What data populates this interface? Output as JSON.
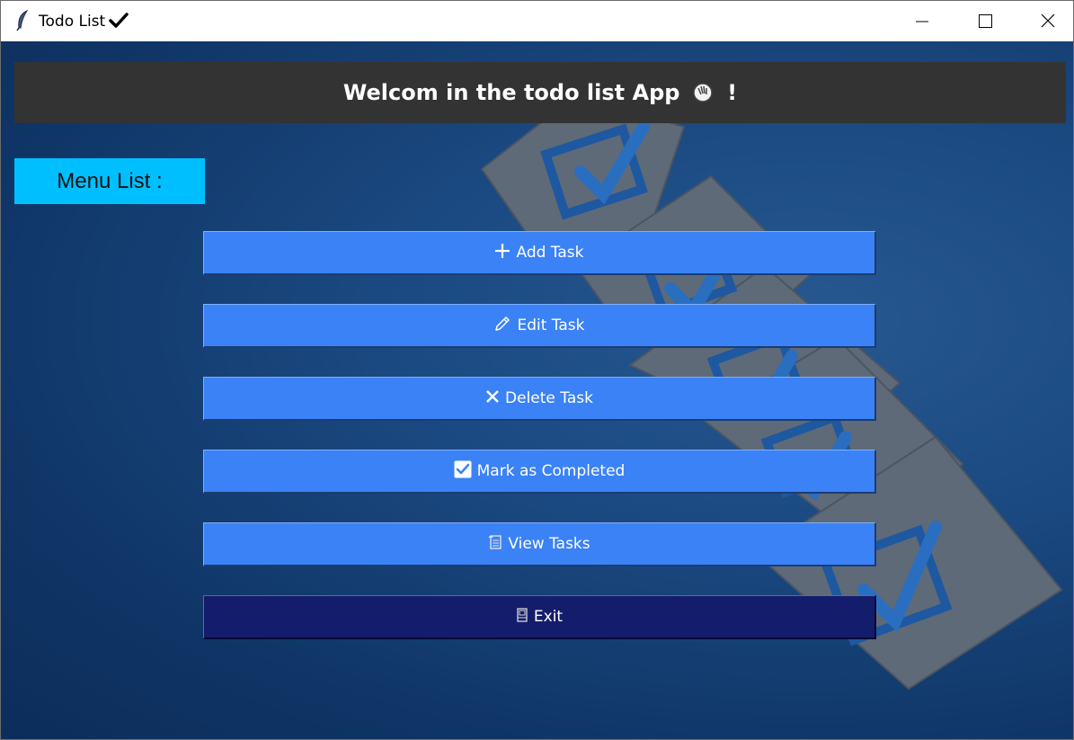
{
  "window": {
    "title": "Todo List",
    "icons": {
      "app": "feather-icon",
      "title_suffix": "checkmark-icon",
      "minimize": "minimize-icon",
      "maximize": "maximize-icon",
      "close": "close-icon"
    }
  },
  "header": {
    "title_prefix": "Welcom in the todo list App",
    "title_suffix": "!",
    "icon": "waving-hand-icon",
    "background": "#333333"
  },
  "menu": {
    "label": "Menu List :",
    "label_color": "#00bfff",
    "items": [
      {
        "label": "Add Task",
        "icon": "plus-icon"
      },
      {
        "label": "Edit Task",
        "icon": "pencil-icon"
      },
      {
        "label": "Delete Task",
        "icon": "x-icon"
      },
      {
        "label": "Mark as Completed",
        "icon": "checkbox-icon"
      },
      {
        "label": "View Tasks",
        "icon": "scroll-icon"
      },
      {
        "label": "Exit",
        "icon": "door-icon"
      }
    ]
  },
  "colors": {
    "button": "#3b82f6",
    "exit_button": "#141d6b",
    "background": "#1b4a82"
  }
}
